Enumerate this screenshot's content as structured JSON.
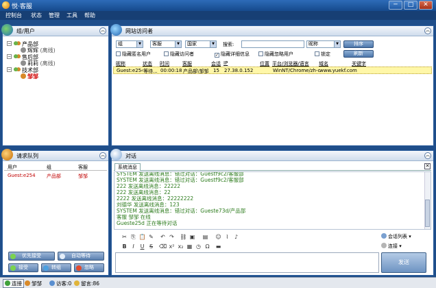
{
  "window": {
    "title": "悦·客服",
    "minimize": "─",
    "maximize": "□",
    "close": "✕"
  },
  "menu": [
    "控制台",
    "状态",
    "管理",
    "工具",
    "帮助"
  ],
  "groups_panel": {
    "title": "组/用户",
    "collapse": "︽",
    "tree": [
      {
        "group": "产品部",
        "users": [
          {
            "name": "辉辉",
            "status": "(离线)"
          }
        ]
      },
      {
        "group": "售后部",
        "users": [
          {
            "name": "莉莉",
            "status": "(离线)"
          }
        ]
      },
      {
        "group": "技术部",
        "users": [
          {
            "name": "邹邹",
            "status": ""
          }
        ]
      }
    ]
  },
  "visitor_panel": {
    "title": "网站访问者",
    "collapse": "︽",
    "filters": {
      "group": "组",
      "agent": "客服",
      "country": "国家",
      "search_label": "搜索:",
      "nickname": "昵称",
      "sort_button": "排序",
      "refresh_button": "刷新"
    },
    "checkboxes": [
      {
        "label": "隐藏匿名用户",
        "checked": false
      },
      {
        "label": "隐藏访问者",
        "checked": false
      },
      {
        "label": "隐藏详细信息",
        "checked": true
      },
      {
        "label": "隐藏忽略用户",
        "checked": false
      },
      {
        "label": "锁定",
        "checked": false
      }
    ],
    "columns": [
      "昵称",
      "状态",
      "时间",
      "客服",
      "会话",
      "IP",
      "位置",
      "平台/浏览器/语言",
      "域名",
      "关键字"
    ],
    "rows": [
      {
        "nickname": "Guest:e254",
        "status": "等待...",
        "time": "00:00:18",
        "agent": "产品部\\邹邹",
        "session": "15",
        "ip": "27.38.0.152",
        "location": "",
        "platform": "WinNT/Chrome/zh-cn",
        "domain": "www.yuekf.com",
        "keyword": ""
      }
    ]
  },
  "queue_panel": {
    "title": "请求队列",
    "collapse": "︽",
    "columns": [
      "用户",
      "组",
      "客服"
    ],
    "rows": [
      {
        "user": "Guest:e254",
        "group": "产品部",
        "agent": "邹邹"
      }
    ],
    "buttons": {
      "priority": "优先接受",
      "auto_wait": "自动等待",
      "accept": "接受",
      "forward": "转组",
      "ignore": "忽略"
    }
  },
  "dialog_panel": {
    "title": "对话",
    "collapse": "︽",
    "tab": "系统消息",
    "tab_close": "✕",
    "messages": [
      "SYSTEM 发送离线消息：错过对话：Guestf9c2/客服部",
      "SYSTEM 发送离线消息：错过对话：Guestf9c2/客服部",
      "222 发送离线消息：22222",
      "222 发送离线消息：22",
      "2222 发送离线消息：22222222",
      "刘德华 发送离线消息：123",
      "SYSTEM 发送离线消息：错过对话：Gueste73d/产品部",
      "客服 邹邹 在线",
      "Gueste25d 正在等待对话"
    ],
    "side_buttons": {
      "session_list": "会话列表",
      "connect": "连接"
    },
    "send": "发送"
  },
  "statusbar": {
    "connection": "连接",
    "user": "邹邹",
    "visitors": "访客:0",
    "messages": "留言:86"
  },
  "colors": {
    "frame": "#1f4e8a",
    "message_green": "#2a7a1a",
    "highlight_row": "#fff7a8",
    "queue_red": "#c00000"
  }
}
